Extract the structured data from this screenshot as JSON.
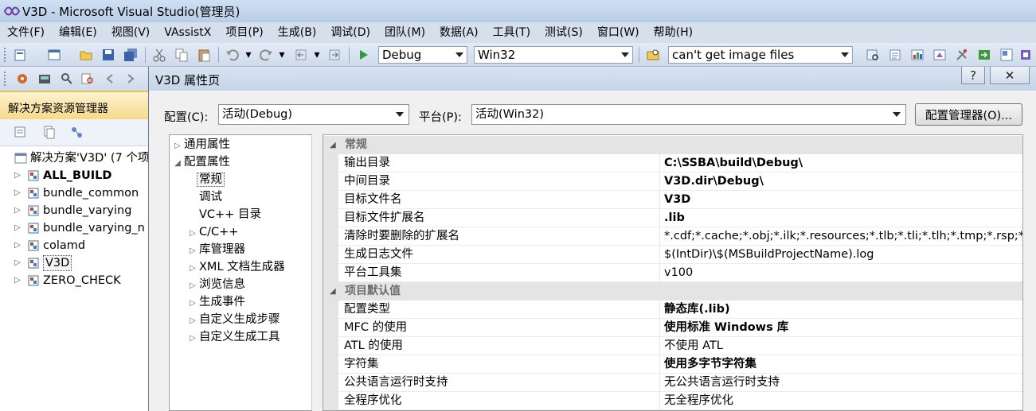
{
  "window": {
    "title": "V3D - Microsoft Visual Studio(管理员)"
  },
  "menu": [
    "文件(F)",
    "编辑(E)",
    "视图(V)",
    "VAssistX",
    "项目(P)",
    "生成(B)",
    "调试(D)",
    "团队(M)",
    "数据(A)",
    "工具(T)",
    "测试(S)",
    "窗口(W)",
    "帮助(H)"
  ],
  "toolbar": {
    "configuration": "Debug",
    "platform": "Win32",
    "find": "can't get image files"
  },
  "solution_explorer": {
    "title": "解决方案资源管理器",
    "root": "解决方案'V3D' (7 个项",
    "projects": [
      {
        "name": "ALL_BUILD",
        "bold": true
      },
      {
        "name": "bundle_common",
        "bold": false
      },
      {
        "name": "bundle_varying",
        "bold": false
      },
      {
        "name": "bundle_varying_n",
        "bold": false
      },
      {
        "name": "colamd",
        "bold": false
      },
      {
        "name": "V3D",
        "bold": false
      },
      {
        "name": "ZERO_CHECK",
        "bold": false
      }
    ]
  },
  "dialog": {
    "title": "V3D 属性页",
    "help_glyph": "?",
    "close_glyph": "✕",
    "config_label": "配置(C):",
    "config_value": "活动(Debug)",
    "platform_label": "平台(P):",
    "platform_value": "活动(Win32)",
    "config_manager_button": "配置管理器(O)...",
    "nav": {
      "common": "通用属性",
      "config": "配置属性",
      "items": {
        "general": "常规",
        "debugging": "调试",
        "vcdirs": "VC++ 目录",
        "cpp": "C/C++",
        "librarian": "库管理器",
        "xmldoc": "XML 文档生成器",
        "browse": "浏览信息",
        "buildevents": "生成事件",
        "customstep": "自定义生成步骤",
        "customtool": "自定义生成工具"
      }
    },
    "grid": {
      "cat_general": "常规",
      "cat_defaults": "项目默认值",
      "general_rows": [
        {
          "name": "输出目录",
          "value": "C:\\SSBA\\build\\Debug\\",
          "bold": true
        },
        {
          "name": "中间目录",
          "value": "V3D.dir\\Debug\\",
          "bold": true
        },
        {
          "name": "目标文件名",
          "value": "V3D",
          "bold": true
        },
        {
          "name": "目标文件扩展名",
          "value": ".lib",
          "bold": true
        },
        {
          "name": "清除时要删除的扩展名",
          "value": "*.cdf;*.cache;*.obj;*.ilk;*.resources;*.tlb;*.tli;*.tlh;*.tmp;*.rsp;*.p",
          "bold": false
        },
        {
          "name": "生成日志文件",
          "value": "$(IntDir)\\$(MSBuildProjectName).log",
          "bold": false
        },
        {
          "name": "平台工具集",
          "value": "v100",
          "bold": false
        }
      ],
      "default_rows": [
        {
          "name": "配置类型",
          "value": "静态库(.lib)",
          "bold": true
        },
        {
          "name": "MFC 的使用",
          "value": "使用标准 Windows 库",
          "bold": true
        },
        {
          "name": "ATL 的使用",
          "value": "不使用 ATL",
          "bold": false
        },
        {
          "name": "字符集",
          "value": "使用多字节字符集",
          "bold": true
        },
        {
          "name": "公共语言运行时支持",
          "value": "无公共语言运行时支持",
          "bold": false
        },
        {
          "name": "全程序优化",
          "value": "无全程序优化",
          "bold": false
        }
      ]
    }
  }
}
